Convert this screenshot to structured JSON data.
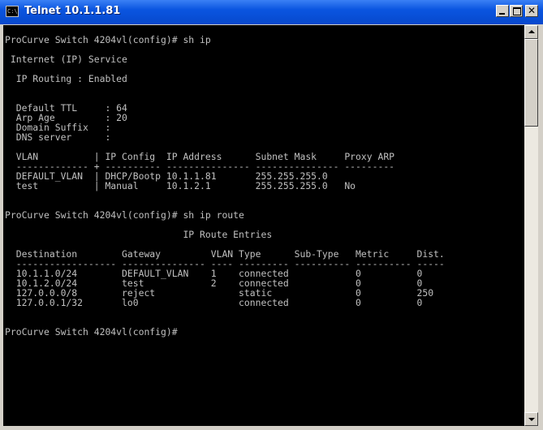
{
  "window": {
    "title": "Telnet 10.1.1.81",
    "icon_text": "C:\\",
    "close_glyph": "✕"
  },
  "console": {
    "lines": [
      "ProCurve Switch 4204vl(config)# sh ip",
      "",
      " Internet (IP) Service",
      "",
      "  IP Routing : Enabled",
      "",
      "",
      "  Default TTL     : 64",
      "  Arp Age         : 20",
      "  Domain Suffix   :",
      "  DNS server      :",
      "",
      "  VLAN          | IP Config  IP Address      Subnet Mask     Proxy ARP",
      "  ------------- + ---------- --------------- --------------- ---------",
      "  DEFAULT_VLAN  | DHCP/Bootp 10.1.1.81       255.255.255.0",
      "  test          | Manual     10.1.2.1        255.255.255.0   No",
      "",
      "",
      "ProCurve Switch 4204vl(config)# sh ip route",
      "",
      "                                IP Route Entries",
      "",
      "  Destination        Gateway         VLAN Type      Sub-Type   Metric     Dist.",
      "  ------------------ --------------- ---- --------- ---------- ---------- -----",
      "  10.1.1.0/24        DEFAULT_VLAN    1    connected            0          0",
      "  10.1.2.0/24        test            2    connected            0          0",
      "  127.0.0.0/8        reject               static               0          250",
      "  127.0.0.1/32       lo0                  connected            0          0",
      "",
      "",
      "",
      "ProCurve Switch 4204vl(config)# "
    ]
  }
}
